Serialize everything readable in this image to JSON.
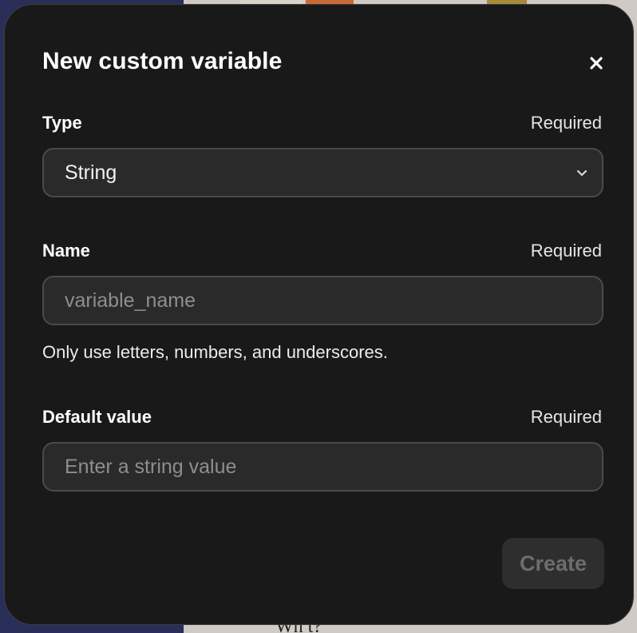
{
  "background": {
    "bottom_text": "Wh  t?"
  },
  "modal": {
    "title": "New custom variable",
    "close_icon": "close-icon",
    "type_field": {
      "label": "Type",
      "required_text": "Required",
      "selected_value": "String",
      "icon": "chevron-down-icon"
    },
    "name_field": {
      "label": "Name",
      "required_text": "Required",
      "placeholder": "variable_name",
      "value": "",
      "helper_text": "Only use letters, numbers, and underscores."
    },
    "default_value_field": {
      "label": "Default value",
      "required_text": "Required",
      "placeholder": "Enter a string value",
      "value": ""
    },
    "create_button": {
      "label": "Create",
      "disabled": true
    }
  },
  "colors": {
    "modal_bg": "#191919",
    "field_bg": "#2a2a2a",
    "field_border": "#4a4a4a",
    "placeholder": "#8e8e8e",
    "button_disabled_bg": "#2e2e2e",
    "button_disabled_text": "#6d6d6d"
  }
}
